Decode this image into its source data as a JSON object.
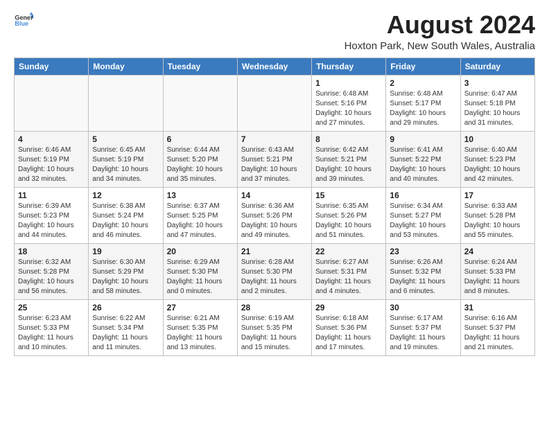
{
  "header": {
    "logo_general": "General",
    "logo_blue": "Blue",
    "month_year": "August 2024",
    "location": "Hoxton Park, New South Wales, Australia"
  },
  "calendar": {
    "days_of_week": [
      "Sunday",
      "Monday",
      "Tuesday",
      "Wednesday",
      "Thursday",
      "Friday",
      "Saturday"
    ],
    "weeks": [
      [
        {
          "day": "",
          "info": ""
        },
        {
          "day": "",
          "info": ""
        },
        {
          "day": "",
          "info": ""
        },
        {
          "day": "",
          "info": ""
        },
        {
          "day": "1",
          "info": "Sunrise: 6:48 AM\nSunset: 5:16 PM\nDaylight: 10 hours and 27 minutes."
        },
        {
          "day": "2",
          "info": "Sunrise: 6:48 AM\nSunset: 5:17 PM\nDaylight: 10 hours and 29 minutes."
        },
        {
          "day": "3",
          "info": "Sunrise: 6:47 AM\nSunset: 5:18 PM\nDaylight: 10 hours and 31 minutes."
        }
      ],
      [
        {
          "day": "4",
          "info": "Sunrise: 6:46 AM\nSunset: 5:19 PM\nDaylight: 10 hours and 32 minutes."
        },
        {
          "day": "5",
          "info": "Sunrise: 6:45 AM\nSunset: 5:19 PM\nDaylight: 10 hours and 34 minutes."
        },
        {
          "day": "6",
          "info": "Sunrise: 6:44 AM\nSunset: 5:20 PM\nDaylight: 10 hours and 35 minutes."
        },
        {
          "day": "7",
          "info": "Sunrise: 6:43 AM\nSunset: 5:21 PM\nDaylight: 10 hours and 37 minutes."
        },
        {
          "day": "8",
          "info": "Sunrise: 6:42 AM\nSunset: 5:21 PM\nDaylight: 10 hours and 39 minutes."
        },
        {
          "day": "9",
          "info": "Sunrise: 6:41 AM\nSunset: 5:22 PM\nDaylight: 10 hours and 40 minutes."
        },
        {
          "day": "10",
          "info": "Sunrise: 6:40 AM\nSunset: 5:23 PM\nDaylight: 10 hours and 42 minutes."
        }
      ],
      [
        {
          "day": "11",
          "info": "Sunrise: 6:39 AM\nSunset: 5:23 PM\nDaylight: 10 hours and 44 minutes."
        },
        {
          "day": "12",
          "info": "Sunrise: 6:38 AM\nSunset: 5:24 PM\nDaylight: 10 hours and 46 minutes."
        },
        {
          "day": "13",
          "info": "Sunrise: 6:37 AM\nSunset: 5:25 PM\nDaylight: 10 hours and 47 minutes."
        },
        {
          "day": "14",
          "info": "Sunrise: 6:36 AM\nSunset: 5:26 PM\nDaylight: 10 hours and 49 minutes."
        },
        {
          "day": "15",
          "info": "Sunrise: 6:35 AM\nSunset: 5:26 PM\nDaylight: 10 hours and 51 minutes."
        },
        {
          "day": "16",
          "info": "Sunrise: 6:34 AM\nSunset: 5:27 PM\nDaylight: 10 hours and 53 minutes."
        },
        {
          "day": "17",
          "info": "Sunrise: 6:33 AM\nSunset: 5:28 PM\nDaylight: 10 hours and 55 minutes."
        }
      ],
      [
        {
          "day": "18",
          "info": "Sunrise: 6:32 AM\nSunset: 5:28 PM\nDaylight: 10 hours and 56 minutes."
        },
        {
          "day": "19",
          "info": "Sunrise: 6:30 AM\nSunset: 5:29 PM\nDaylight: 10 hours and 58 minutes."
        },
        {
          "day": "20",
          "info": "Sunrise: 6:29 AM\nSunset: 5:30 PM\nDaylight: 11 hours and 0 minutes."
        },
        {
          "day": "21",
          "info": "Sunrise: 6:28 AM\nSunset: 5:30 PM\nDaylight: 11 hours and 2 minutes."
        },
        {
          "day": "22",
          "info": "Sunrise: 6:27 AM\nSunset: 5:31 PM\nDaylight: 11 hours and 4 minutes."
        },
        {
          "day": "23",
          "info": "Sunrise: 6:26 AM\nSunset: 5:32 PM\nDaylight: 11 hours and 6 minutes."
        },
        {
          "day": "24",
          "info": "Sunrise: 6:24 AM\nSunset: 5:33 PM\nDaylight: 11 hours and 8 minutes."
        }
      ],
      [
        {
          "day": "25",
          "info": "Sunrise: 6:23 AM\nSunset: 5:33 PM\nDaylight: 11 hours and 10 minutes."
        },
        {
          "day": "26",
          "info": "Sunrise: 6:22 AM\nSunset: 5:34 PM\nDaylight: 11 hours and 11 minutes."
        },
        {
          "day": "27",
          "info": "Sunrise: 6:21 AM\nSunset: 5:35 PM\nDaylight: 11 hours and 13 minutes."
        },
        {
          "day": "28",
          "info": "Sunrise: 6:19 AM\nSunset: 5:35 PM\nDaylight: 11 hours and 15 minutes."
        },
        {
          "day": "29",
          "info": "Sunrise: 6:18 AM\nSunset: 5:36 PM\nDaylight: 11 hours and 17 minutes."
        },
        {
          "day": "30",
          "info": "Sunrise: 6:17 AM\nSunset: 5:37 PM\nDaylight: 11 hours and 19 minutes."
        },
        {
          "day": "31",
          "info": "Sunrise: 6:16 AM\nSunset: 5:37 PM\nDaylight: 11 hours and 21 minutes."
        }
      ]
    ]
  }
}
